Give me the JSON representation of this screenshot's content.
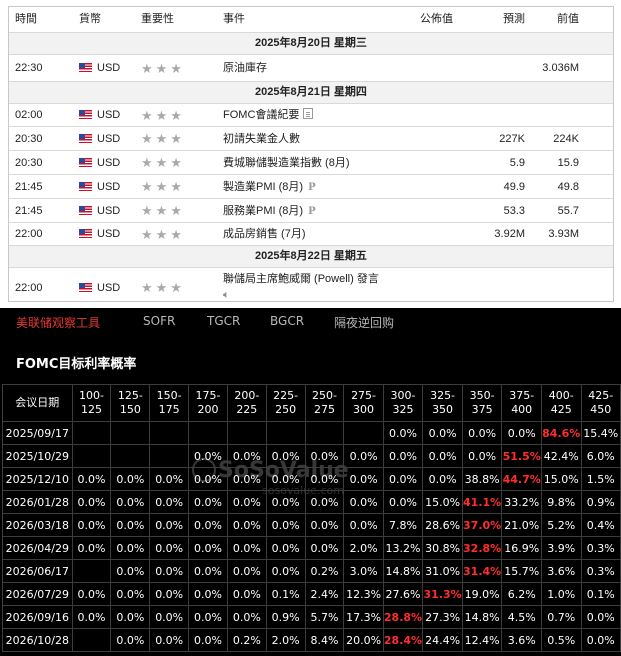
{
  "calendar": {
    "headers": {
      "time": "時間",
      "currency": "貨幣",
      "importance": "重要性",
      "event": "事件",
      "actual": "公佈值",
      "forecast": "預測",
      "previous": "前值"
    },
    "day1": "2025年8月20日 星期三",
    "day2": "2025年8月21日 星期四",
    "day3": "2025年8月22日 星期五",
    "rows": [
      {
        "time": "22:30",
        "currency": "USD",
        "stars": "★★★",
        "event": "原油庫存",
        "actual": "",
        "forecast": "",
        "previous": "3.036M"
      },
      {
        "time": "02:00",
        "currency": "USD",
        "stars": "★★★",
        "event": "FOMC會議紀要",
        "actual": "",
        "forecast": "",
        "previous": ""
      },
      {
        "time": "20:30",
        "currency": "USD",
        "stars": "★★★",
        "event": "初請失業金人數",
        "actual": "",
        "forecast": "227K",
        "previous": "224K"
      },
      {
        "time": "20:30",
        "currency": "USD",
        "stars": "★★★",
        "event": "費城聯儲製造業指數 (8月)",
        "actual": "",
        "forecast": "5.9",
        "previous": "15.9"
      },
      {
        "time": "21:45",
        "currency": "USD",
        "stars": "★★★",
        "event": "製造業PMI (8月)",
        "actual": "",
        "forecast": "49.9",
        "previous": "49.8"
      },
      {
        "time": "21:45",
        "currency": "USD",
        "stars": "★★★",
        "event": "服務業PMI (8月)",
        "actual": "",
        "forecast": "53.3",
        "previous": "55.7"
      },
      {
        "time": "22:00",
        "currency": "USD",
        "stars": "★★★",
        "event": "成品房銷售 (7月)",
        "actual": "",
        "forecast": "3.92M",
        "previous": "3.93M"
      },
      {
        "time": "22:00",
        "currency": "USD",
        "stars": "★★★",
        "event": "聯儲局主席鮑威爾 (Powell) 發言",
        "actual": "",
        "forecast": "",
        "previous": ""
      }
    ],
    "prelim_badge": "P"
  },
  "tabs": [
    "美联储观察工具",
    "SOFR",
    "TGCR",
    "BGCR",
    "隔夜逆回购"
  ],
  "fomc": {
    "title": "FOMC目标利率概率",
    "date_header": "会议日期",
    "ranges": [
      [
        "100-",
        "125"
      ],
      [
        "125-",
        "150"
      ],
      [
        "150-",
        "175"
      ],
      [
        "175-",
        "200"
      ],
      [
        "200-",
        "225"
      ],
      [
        "225-",
        "250"
      ],
      [
        "250-",
        "275"
      ],
      [
        "275-",
        "300"
      ],
      [
        "300-",
        "325"
      ],
      [
        "325-",
        "350"
      ],
      [
        "350-",
        "375"
      ],
      [
        "375-",
        "400"
      ],
      [
        "400-",
        "425"
      ],
      [
        "425-",
        "450"
      ]
    ],
    "rows": [
      {
        "date": "2025/09/17",
        "cells": [
          "",
          "",
          "",
          "",
          "",
          "",
          "",
          "",
          "0.0%",
          "0.0%",
          "0.0%",
          "0.0%",
          "84.6%",
          "15.4%"
        ],
        "hi": 12
      },
      {
        "date": "2025/10/29",
        "cells": [
          "",
          "",
          "",
          "0.0%",
          "0.0%",
          "0.0%",
          "0.0%",
          "0.0%",
          "0.0%",
          "0.0%",
          "0.0%",
          "51.5%",
          "42.4%",
          "6.0%"
        ],
        "hi": 11
      },
      {
        "date": "2025/12/10",
        "cells": [
          "0.0%",
          "0.0%",
          "0.0%",
          "0.0%",
          "0.0%",
          "0.0%",
          "0.0%",
          "0.0%",
          "0.0%",
          "0.0%",
          "38.8%",
          "44.7%",
          "15.0%",
          "1.5%"
        ],
        "hi": 11
      },
      {
        "date": "2026/01/28",
        "cells": [
          "0.0%",
          "0.0%",
          "0.0%",
          "0.0%",
          "0.0%",
          "0.0%",
          "0.0%",
          "0.0%",
          "0.0%",
          "15.0%",
          "41.1%",
          "33.2%",
          "9.8%",
          "0.9%"
        ],
        "hi": 10
      },
      {
        "date": "2026/03/18",
        "cells": [
          "0.0%",
          "0.0%",
          "0.0%",
          "0.0%",
          "0.0%",
          "0.0%",
          "0.0%",
          "0.0%",
          "7.8%",
          "28.6%",
          "37.0%",
          "21.0%",
          "5.2%",
          "0.4%"
        ],
        "hi": 10
      },
      {
        "date": "2026/04/29",
        "cells": [
          "0.0%",
          "0.0%",
          "0.0%",
          "0.0%",
          "0.0%",
          "0.0%",
          "0.0%",
          "2.0%",
          "13.2%",
          "30.8%",
          "32.8%",
          "16.9%",
          "3.9%",
          "0.3%"
        ],
        "hi": 10
      },
      {
        "date": "2026/06/17",
        "cells": [
          "0.0%",
          "0.0%",
          "0.0%",
          "0.0%",
          "0.0%",
          "0.2%",
          "3.0%",
          "14.8%",
          "31.0%",
          "31.4%",
          "15.7%",
          "3.6%",
          "0.3%"
        ],
        "hi": 9,
        "shift": true
      },
      {
        "date": "2026/07/29",
        "cells": [
          "0.0%",
          "0.0%",
          "0.0%",
          "0.0%",
          "0.0%",
          "0.1%",
          "2.4%",
          "12.3%",
          "27.6%",
          "31.3%",
          "19.0%",
          "6.2%",
          "1.0%",
          "0.1%"
        ],
        "hi": 9
      },
      {
        "date": "2026/09/16",
        "cells": [
          "0.0%",
          "0.0%",
          "0.0%",
          "0.0%",
          "0.0%",
          "0.9%",
          "5.7%",
          "17.3%",
          "28.8%",
          "27.3%",
          "14.8%",
          "4.5%",
          "0.7%",
          "0.0%"
        ],
        "hi": 8
      },
      {
        "date": "2026/10/28",
        "cells": [
          "0.0%",
          "0.0%",
          "0.0%",
          "0.2%",
          "2.0%",
          "8.4%",
          "20.0%",
          "28.4%",
          "24.4%",
          "12.4%",
          "3.6%",
          "0.5%",
          "0.0%"
        ],
        "hi": 7,
        "shift": true
      }
    ]
  },
  "watermark": {
    "brand": "SoSoValue",
    "url": "sosovalue.com"
  },
  "colors": {
    "accent_red": "#ff2d2d",
    "tab_active": "#e53935",
    "panel_bg": "#000000"
  }
}
